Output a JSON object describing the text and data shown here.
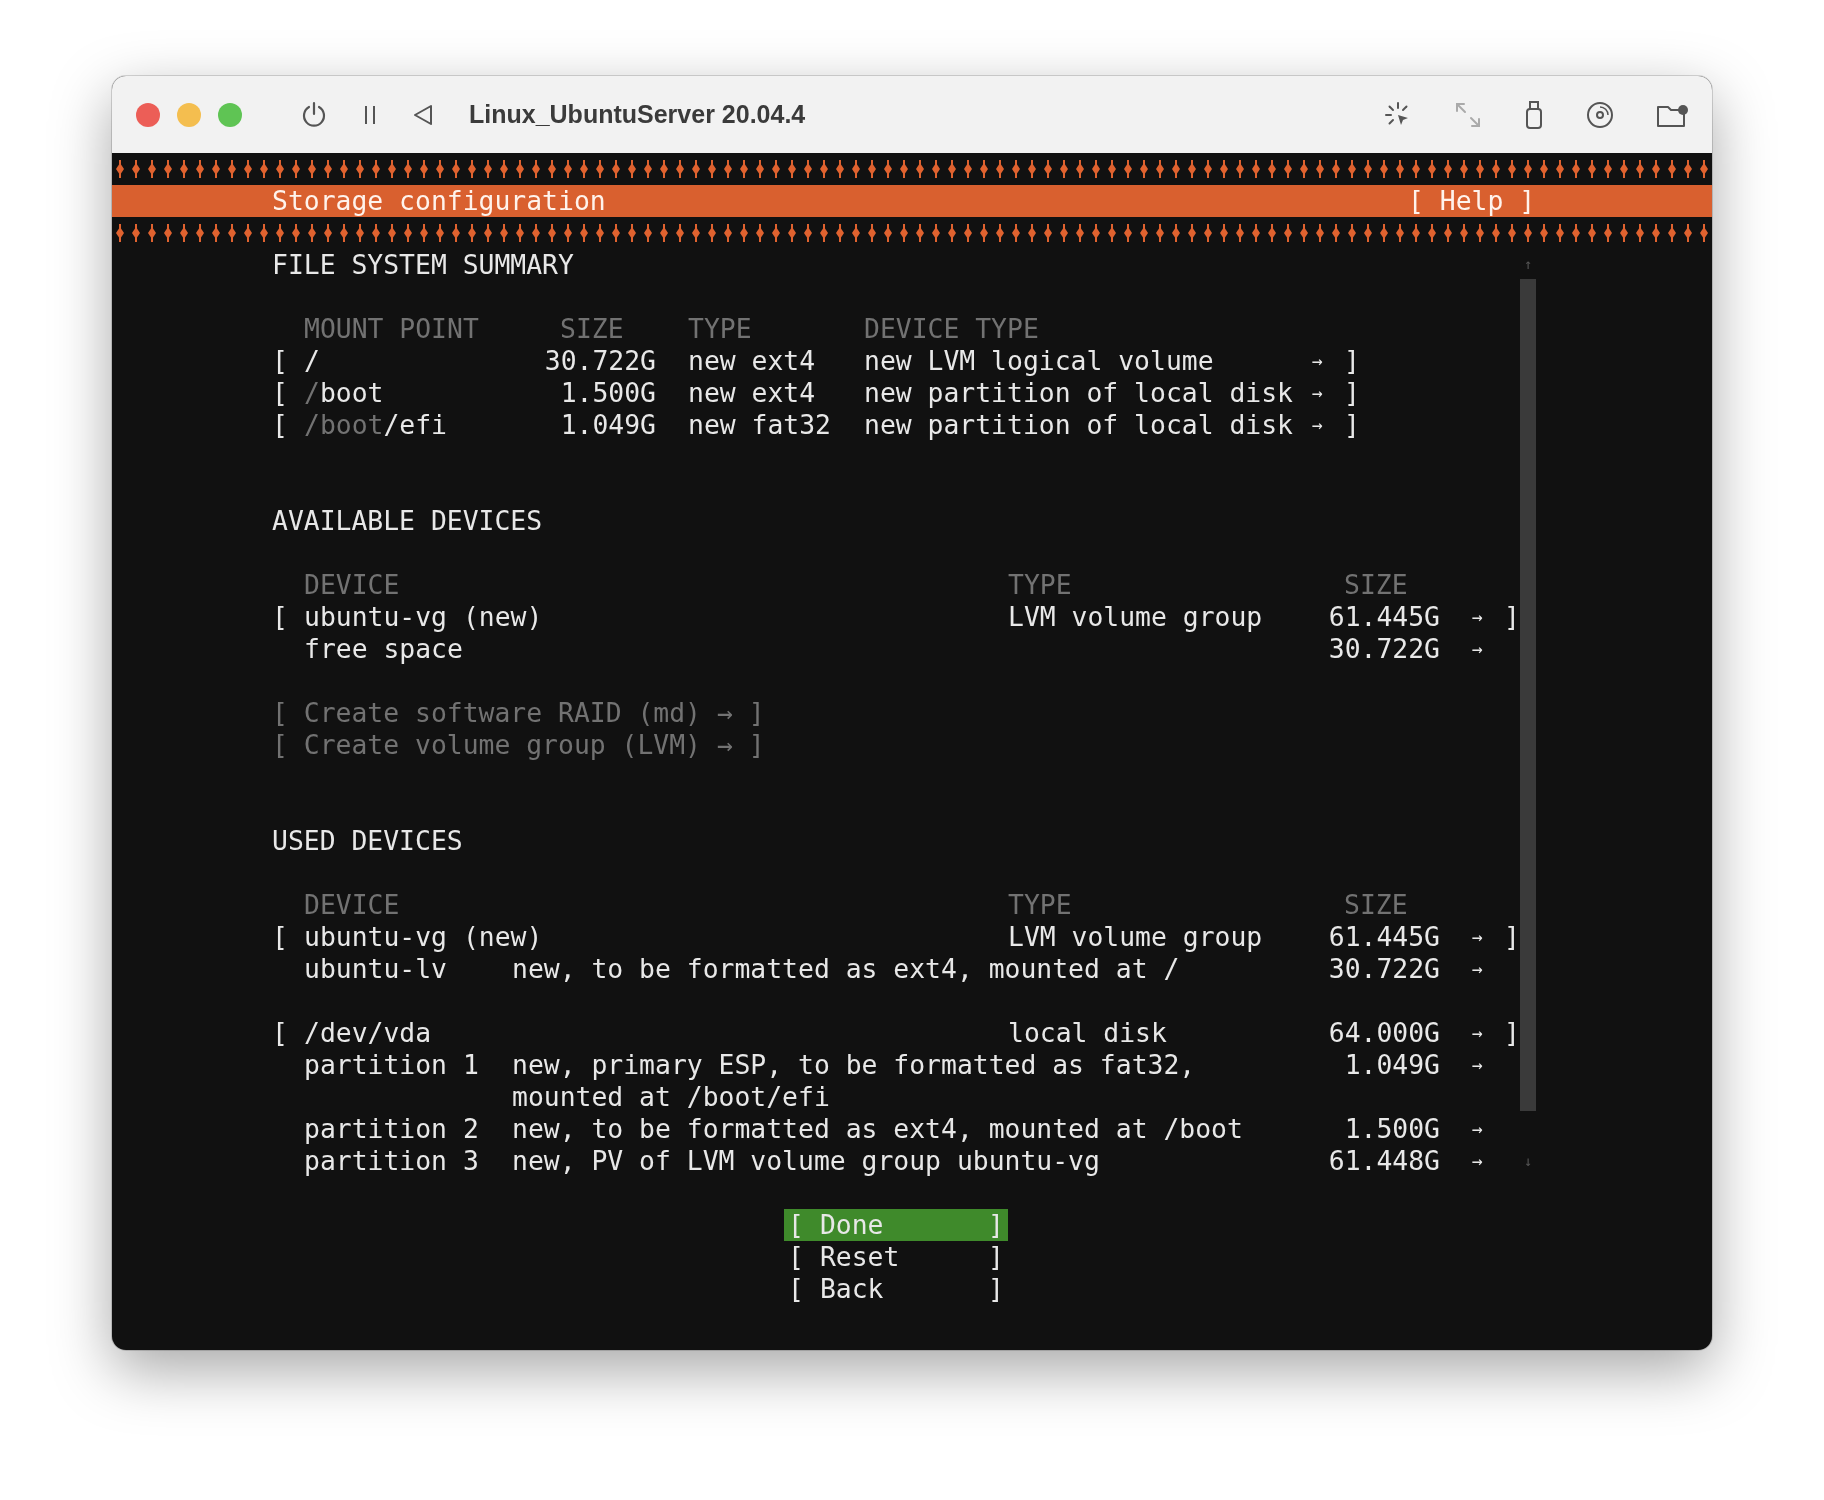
{
  "window": {
    "title": "Linux_UbuntuServer 20.04.4"
  },
  "header": {
    "title": "Storage configuration",
    "help": "[ Help ]"
  },
  "file_system_summary": {
    "heading": "FILE SYSTEM SUMMARY",
    "columns": [
      "MOUNT POINT",
      "SIZE",
      "TYPE",
      "DEVICE TYPE"
    ],
    "rows": [
      {
        "open": "[",
        "mount": [
          {
            "text": "/",
            "dim": false
          }
        ],
        "size": "30.722G",
        "type": "new ext4",
        "device_type": "new LVM logical volume",
        "arrow": "→",
        "close": "]"
      },
      {
        "open": "[",
        "mount": [
          {
            "text": "/",
            "dim": true
          },
          {
            "text": "boot",
            "dim": false
          }
        ],
        "size": "1.500G",
        "type": "new ext4",
        "device_type": "new partition of local disk",
        "arrow": "→",
        "close": "]"
      },
      {
        "open": "[",
        "mount": [
          {
            "text": "/boot",
            "dim": true
          },
          {
            "text": "/efi",
            "dim": false
          }
        ],
        "size": "1.049G",
        "type": "new fat32",
        "device_type": "new partition of local disk",
        "arrow": "→",
        "close": "]"
      }
    ]
  },
  "available_devices": {
    "heading": "AVAILABLE DEVICES",
    "columns": [
      "DEVICE",
      "TYPE",
      "SIZE"
    ],
    "rows": [
      {
        "kind": "device",
        "open": "[",
        "name": "ubuntu-vg (new)",
        "type": "LVM volume group",
        "size": "61.445G",
        "arrow": "→",
        "close": "]"
      },
      {
        "kind": "sub",
        "name": "free space",
        "size": "30.722G",
        "arrow": "→"
      }
    ],
    "actions": [
      {
        "text": "[ Create software RAID (md) → ]",
        "disabled": true
      },
      {
        "text": "[ Create volume group (LVM) → ]",
        "disabled": true
      }
    ]
  },
  "used_devices": {
    "heading": "USED DEVICES",
    "columns": [
      "DEVICE",
      "TYPE",
      "SIZE"
    ],
    "groups": [
      {
        "rows": [
          {
            "kind": "device",
            "open": "[",
            "name": "ubuntu-vg (new)",
            "type": "LVM volume group",
            "size": "61.445G",
            "arrow": "→",
            "close": "]"
          },
          {
            "kind": "sub",
            "name": "ubuntu-lv",
            "description": [
              "new, to be formatted as ext4, mounted at /"
            ],
            "size": "30.722G",
            "arrow": "→"
          }
        ]
      },
      {
        "rows": [
          {
            "kind": "device",
            "open": "[",
            "name": "/dev/vda",
            "type": "local disk",
            "size": "64.000G",
            "arrow": "→",
            "close": "]"
          },
          {
            "kind": "sub",
            "name": "partition 1",
            "description": [
              "new, primary ESP, to be formatted as fat32,",
              "mounted at /boot/efi"
            ],
            "size": "1.049G",
            "arrow": "→"
          },
          {
            "kind": "sub",
            "name": "partition 2",
            "description": [
              "new, to be formatted as ext4, mounted at /boot"
            ],
            "size": "1.500G",
            "arrow": "→"
          },
          {
            "kind": "sub",
            "name": "partition 3",
            "description": [
              "new, PV of LVM volume group ubuntu-vg"
            ],
            "size": "61.448G",
            "arrow": "→"
          }
        ]
      }
    ]
  },
  "scrollbar": {
    "up": "↑",
    "down": "↓"
  },
  "buttons": [
    {
      "open": "[",
      "label": "Done",
      "close": "]",
      "selected": true
    },
    {
      "open": "[",
      "label": "Reset",
      "close": "]",
      "selected": false
    },
    {
      "open": "[",
      "label": "Back",
      "close": "]",
      "selected": false
    }
  ]
}
